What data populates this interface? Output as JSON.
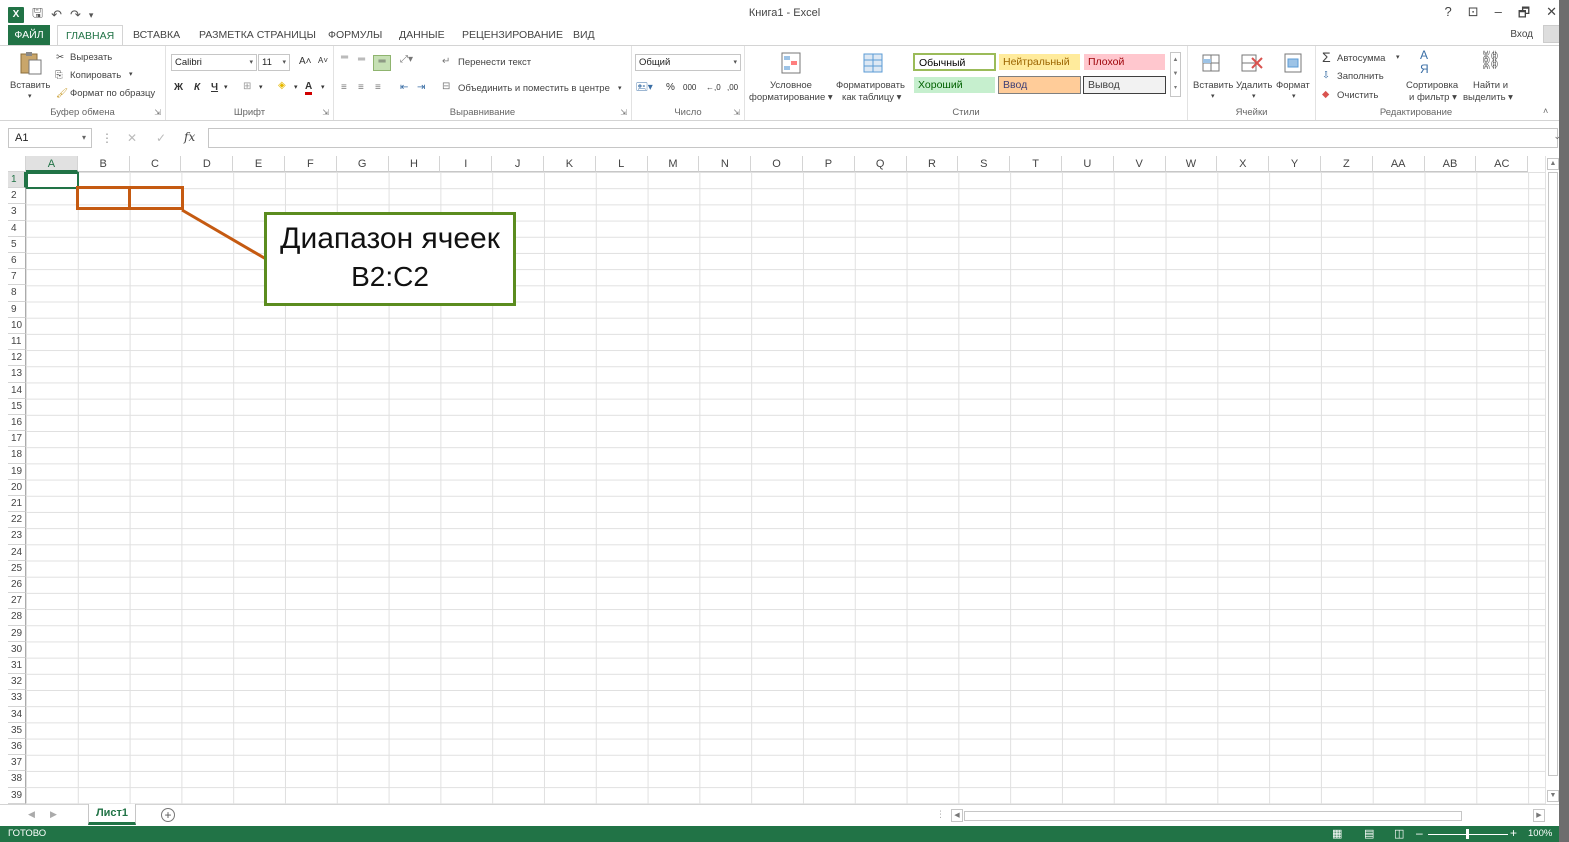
{
  "window": {
    "title": "Книга1 - Excel",
    "help": "?",
    "restore_ribbon": "⊡",
    "minimize": "–",
    "maximize": "🗗",
    "close": "✕"
  },
  "quick_access": {
    "logo": "X",
    "save": "🖫",
    "undo": "↶",
    "redo": "↷",
    "customize": "▾"
  },
  "tabs": [
    {
      "label": "ФАЙЛ"
    },
    {
      "label": "ГЛАВНАЯ"
    },
    {
      "label": "ВСТАВКА"
    },
    {
      "label": "РАЗМЕТКА СТРАНИЦЫ"
    },
    {
      "label": "ФОРМУЛЫ"
    },
    {
      "label": "ДАННЫЕ"
    },
    {
      "label": "РЕЦЕНЗИРОВАНИЕ"
    },
    {
      "label": "ВИД"
    }
  ],
  "sign_in": "Вход",
  "ribbon": {
    "clipboard": {
      "label": "Буфер обмена",
      "paste": "Вставить",
      "cut": "Вырезать",
      "copy": "Копировать",
      "format_painter": "Формат по образцу"
    },
    "font": {
      "label": "Шрифт",
      "font_name": "Calibri",
      "font_size": "11",
      "bold": "Ж",
      "italic": "К",
      "underline": "Ч",
      "grow": "A˄",
      "shrink": "A˅",
      "font_color_letter": "A"
    },
    "alignment": {
      "label": "Выравнивание",
      "wrap_text": "Перенести текст",
      "merge_center": "Объединить и поместить в центре"
    },
    "number": {
      "label": "Число",
      "format": "Общий",
      "percent": "%",
      "thousands": "000",
      "inc_dec": "←,0",
      "dec_dec": ",00"
    },
    "styles": {
      "label": "Стили",
      "conditional": [
        "Условное",
        "форматирование ▾"
      ],
      "format_table": [
        "Форматировать",
        "как таблицу ▾"
      ],
      "cells": [
        {
          "label": "Обычный",
          "bg": "#ffffff",
          "fg": "#000000",
          "border": "#9bbb59"
        },
        {
          "label": "Нейтральный",
          "bg": "#ffeb9c",
          "fg": "#9c6500",
          "border": "#ffffff"
        },
        {
          "label": "Плохой",
          "bg": "#ffc7ce",
          "fg": "#9c0006",
          "border": "#ffffff"
        },
        {
          "label": "Хороший",
          "bg": "#c6efce",
          "fg": "#006100",
          "border": "#ffffff"
        },
        {
          "label": "Ввод",
          "bg": "#ffcc99",
          "fg": "#3f3f76",
          "border": "#7f7f7f"
        },
        {
          "label": "Вывод",
          "bg": "#f2f2f2",
          "fg": "#3f3f3f",
          "border": "#3f3f3f"
        }
      ]
    },
    "cells": {
      "label": "Ячейки",
      "insert": "Вставить",
      "delete": "Удалить",
      "format": "Формат"
    },
    "editing": {
      "label": "Редактирование",
      "autosum": "Автосумма",
      "fill": "Заполнить",
      "clear": "Очистить",
      "sort": [
        "Сортировка",
        "и фильтр ▾"
      ],
      "find": [
        "Найти и",
        "выделить ▾"
      ]
    }
  },
  "formula_bar": {
    "name_box": "A1",
    "fx": "fx",
    "cancel": "✕",
    "enter": "✓",
    "value": ""
  },
  "columns": [
    "A",
    "B",
    "C",
    "D",
    "E",
    "F",
    "G",
    "H",
    "I",
    "J",
    "K",
    "L",
    "M",
    "N",
    "O",
    "P",
    "Q",
    "R",
    "S",
    "T",
    "U",
    "V",
    "W",
    "X",
    "Y",
    "Z",
    "AA",
    "AB",
    "AC"
  ],
  "rows": [
    "1",
    "2",
    "3",
    "4",
    "5",
    "6",
    "7",
    "8",
    "9",
    "10",
    "11",
    "12",
    "13",
    "14",
    "15",
    "16",
    "17",
    "18",
    "19",
    "20",
    "21",
    "22",
    "23",
    "24",
    "25",
    "26",
    "27",
    "28",
    "29",
    "30",
    "31",
    "32",
    "33",
    "34",
    "35",
    "36",
    "37",
    "38",
    "39"
  ],
  "selected": {
    "column": "A",
    "row": "1"
  },
  "annotation": {
    "line1": "Диапазон ячеек",
    "line2": "B2:C2",
    "range_color": "#c55a11",
    "box_color": "#5b8c1f"
  },
  "sheets": [
    {
      "label": "Лист1",
      "active": true
    }
  ],
  "add_sheet": "+",
  "status": {
    "text": "ГОТОВО",
    "zoom": "100%"
  },
  "colors": {
    "accent": "#217346"
  }
}
